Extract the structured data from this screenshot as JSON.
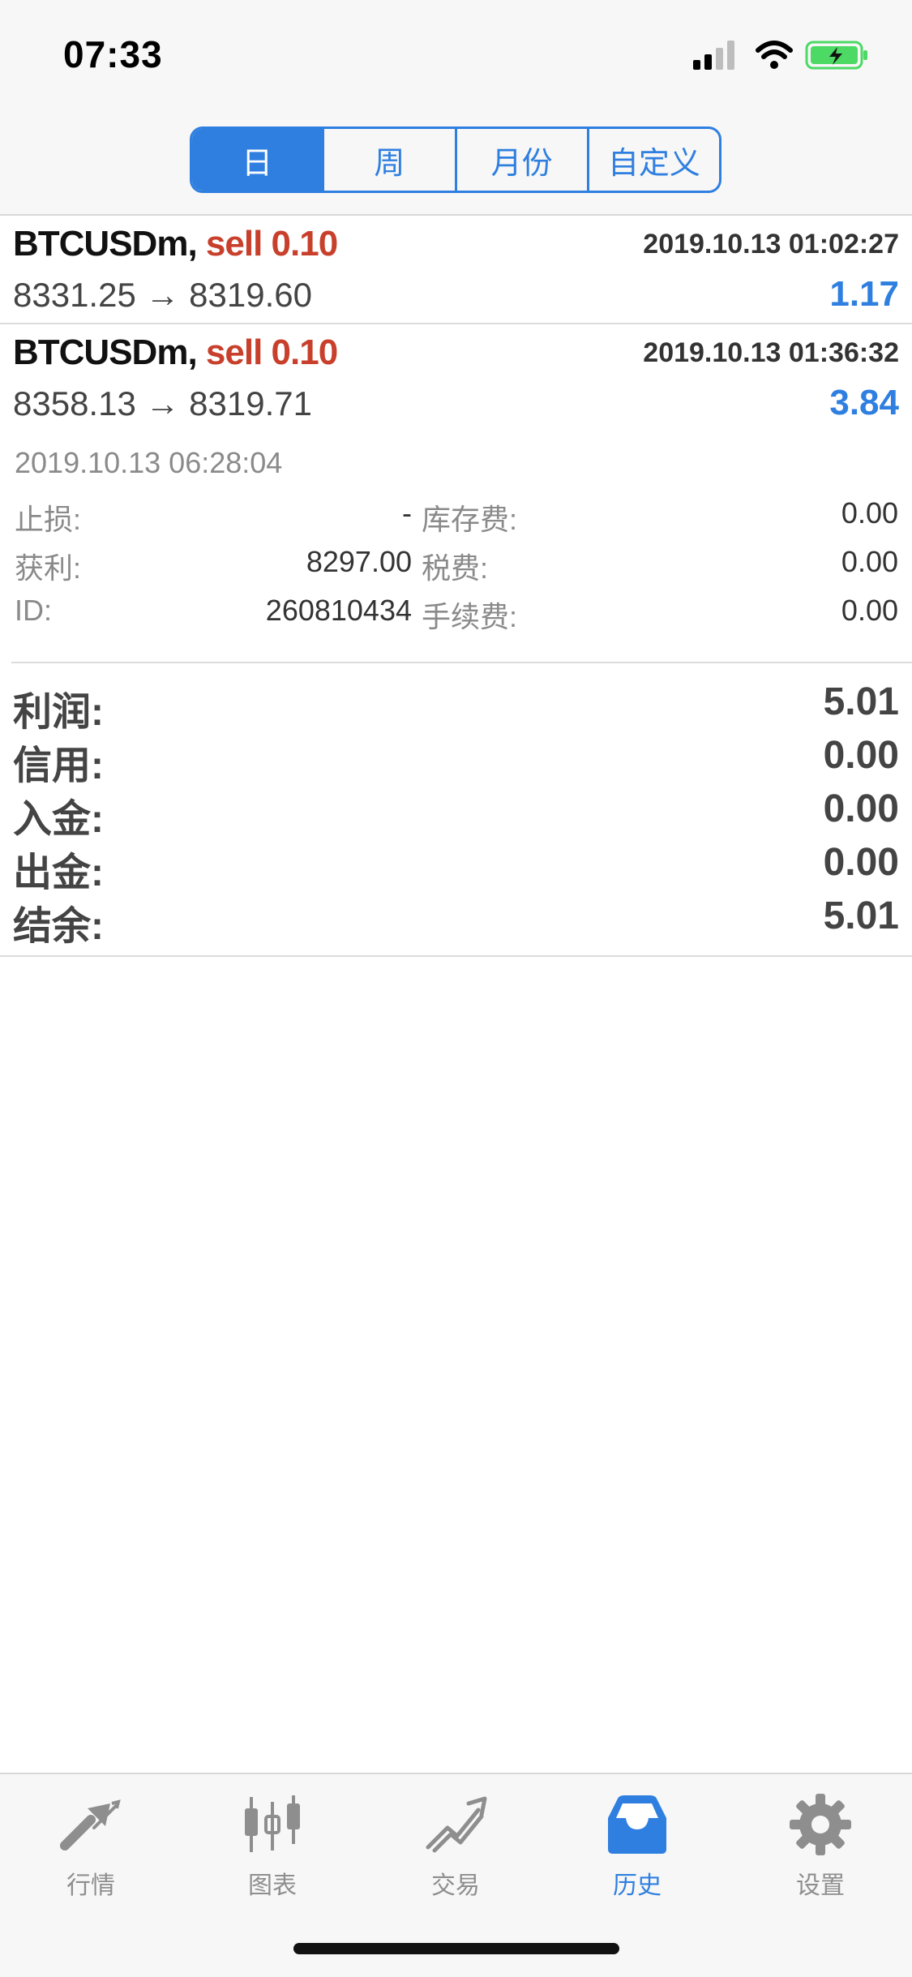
{
  "status_bar": {
    "time": "07:33"
  },
  "segments": [
    {
      "label": "日",
      "active": true
    },
    {
      "label": "周",
      "active": false
    },
    {
      "label": "月份",
      "active": false
    },
    {
      "label": "自定义",
      "active": false
    }
  ],
  "trades": [
    {
      "symbol": "BTCUSDm,",
      "type_volume": "sell 0.10",
      "open_time": "2019.10.13 01:02:27",
      "prices": "8331.25 → 8319.60",
      "profit": "1.17"
    },
    {
      "symbol": "BTCUSDm,",
      "type_volume": "sell 0.10",
      "open_time": "2019.10.13 01:36:32",
      "prices": "8358.13 → 8319.71",
      "profit": "3.84",
      "close_time": "2019.10.13 06:28:04",
      "details": {
        "sl_label": "止损:",
        "sl_value": "-",
        "swap_label": "库存费:",
        "swap_value": "0.00",
        "tp_label": "获利:",
        "tp_value": "8297.00",
        "tax_label": "税费:",
        "tax_value": "0.00",
        "id_label": "ID:",
        "id_value": "260810434",
        "commission_label": "手续费:",
        "commission_value": "0.00"
      }
    }
  ],
  "summary": [
    {
      "label": "利润:",
      "value": "5.01"
    },
    {
      "label": "信用:",
      "value": "0.00"
    },
    {
      "label": "入金:",
      "value": "0.00"
    },
    {
      "label": "出金:",
      "value": "0.00"
    },
    {
      "label": "结余:",
      "value": "5.01"
    }
  ],
  "tabs": [
    {
      "label": "行情",
      "icon": "quotes-arrows-icon",
      "active": false
    },
    {
      "label": "图表",
      "icon": "candlestick-chart-icon",
      "active": false
    },
    {
      "label": "交易",
      "icon": "trade-trend-icon",
      "active": false
    },
    {
      "label": "历史",
      "icon": "history-inbox-icon",
      "active": true
    },
    {
      "label": "设置",
      "icon": "settings-gear-icon",
      "active": false
    }
  ],
  "colors": {
    "accent_blue": "#2f7fe0",
    "sell_red": "#c8402c",
    "battery_green": "#4cd964"
  }
}
